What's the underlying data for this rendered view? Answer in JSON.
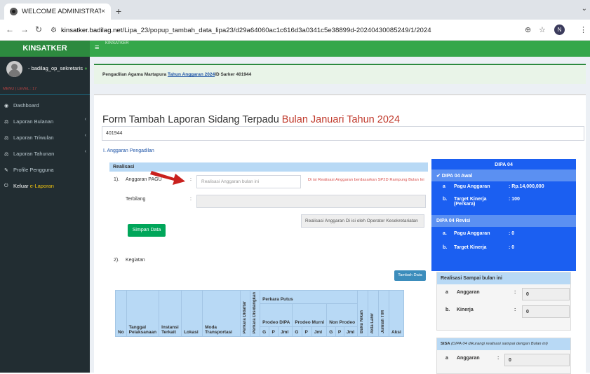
{
  "browser": {
    "tab_title": "WELCOME ADMINISTRATOR",
    "tab_close": "×",
    "new_tab": "+",
    "url_host": "kinsatker.badilag.net",
    "url_path": "/Lipa_23/popup_tambah_data_lipa23/d29a64060ac1c616d3a0341c5e38899d-20240430085249/1/2024",
    "profile_initial": "N"
  },
  "app": {
    "brand": "KINSATKER",
    "topnav_label": "KINSATKER"
  },
  "sidebar": {
    "user_name": "- badilag_op_sekretaris",
    "user_status_icon": "online-dot",
    "menu_level": "MENU | LEVEL : 17",
    "items": [
      {
        "label": "Dashboard",
        "icon": "dashboard-icon",
        "has_children": false
      },
      {
        "label": "Laporan Bulanan",
        "icon": "balance-icon",
        "has_children": true
      },
      {
        "label": "Laporan Triwulan",
        "icon": "balance-icon",
        "has_children": true
      },
      {
        "label": "Laporan Tahunan",
        "icon": "balance-icon",
        "has_children": true
      },
      {
        "label": "Profile Pengguna",
        "icon": "edit-icon",
        "has_children": false
      }
    ],
    "logout_prefix": "Keluar ",
    "logout_accent": "e-Laporan"
  },
  "info_bar": {
    "prefix": "Pengadilan Agama Martapura ",
    "highlight": "Tahun Anggaran 2024",
    "suffix": "ID Sarker 401944"
  },
  "form": {
    "title": "Form Tambah Laporan Sidang Terpadu ",
    "title_red": "Bulan Januari Tahun 2024",
    "id_value": "401944",
    "section_link": "I. Anggaran Pengadilan",
    "realisasi_head": "Realisasi",
    "row1_num": "1).",
    "row1_label": "Anggaran PAGU",
    "colon": ":",
    "anggaran_placeholder": "Realisasi Anggaran bulan ini",
    "anggaran_note": "Di isi Realisasi Anggaran berdasarkan SP2D Rampung Bulan Ini",
    "terbilang_label": "Terbilang",
    "save_button": "Simpan Data",
    "operator_note": "Realisasi Anggaran Di isi oleh Operator Kesekretariatan",
    "row2_num": "2).",
    "row2_label": "Kegiatan",
    "add_button": "Tambah Data"
  },
  "table": {
    "headers": {
      "no": "No",
      "tanggal": "Tanggal Pelaksanaan",
      "instansi": "Instansi Terkait",
      "lokasi": "Lokasi",
      "moda": "Moda Transportasi",
      "didaftar": "Perkara Didaftar",
      "disidangkan": "Perkara Disidangkan",
      "perkara_putus": "Perkara Putus",
      "prodeo_dipa": "Prodeo DIPA",
      "prodeo_murni": "Prodeo Murni",
      "non_prodeo": "Non Prodeo",
      "g": "G",
      "p": "P",
      "jml": "Jml",
      "buku_nikah": "Buku Nikah",
      "akta_lahir": "Akta Lahir",
      "jumlah_tim": "Jumlah TIM",
      "aksi": "Aksi"
    }
  },
  "dipa": {
    "title": "DIPA 04",
    "awal_label": "✔ DIPA 04 Awal",
    "pagu_letter": "a",
    "pagu_label": "Pagu Anggaran",
    "pagu_value": ": Rp.14,000,000",
    "target_letter": "b.",
    "target_label": "Target Kinerja (Perkara)",
    "target_value": ": 100",
    "revisi_label": "DIPA 04 Revisi",
    "rev_pagu_letter": "a.",
    "rev_pagu_label": "Pagu Anggaran",
    "rev_pagu_value": ": 0",
    "rev_target_letter": "b.",
    "rev_target_label": "Target Kinerja",
    "rev_target_value": ": 0"
  },
  "realisasi_box": {
    "head": "Realisasi Sampai bulan ini",
    "a_letter": "a",
    "a_label": "Anggaran",
    "a_value": "0",
    "b_letter": "b.",
    "b_label": "Kinerja",
    "b_value": "0",
    "colon": ":"
  },
  "sisa_box": {
    "head": "SISA",
    "head_note": "(DIPA 04 dikurangi realisasi sampai dengan Bulan ini)",
    "a_letter": "a",
    "a_label": "Anggaran",
    "a_value": "0",
    "colon": ":"
  },
  "colors": {
    "brand_green": "#2d8a3f",
    "nav_green": "#35a74a",
    "sidebar_dark": "#222d32",
    "dipa_blue": "#1b5ff1",
    "table_head_blue": "#b8d9f5",
    "accent_red": "#c0392b"
  }
}
